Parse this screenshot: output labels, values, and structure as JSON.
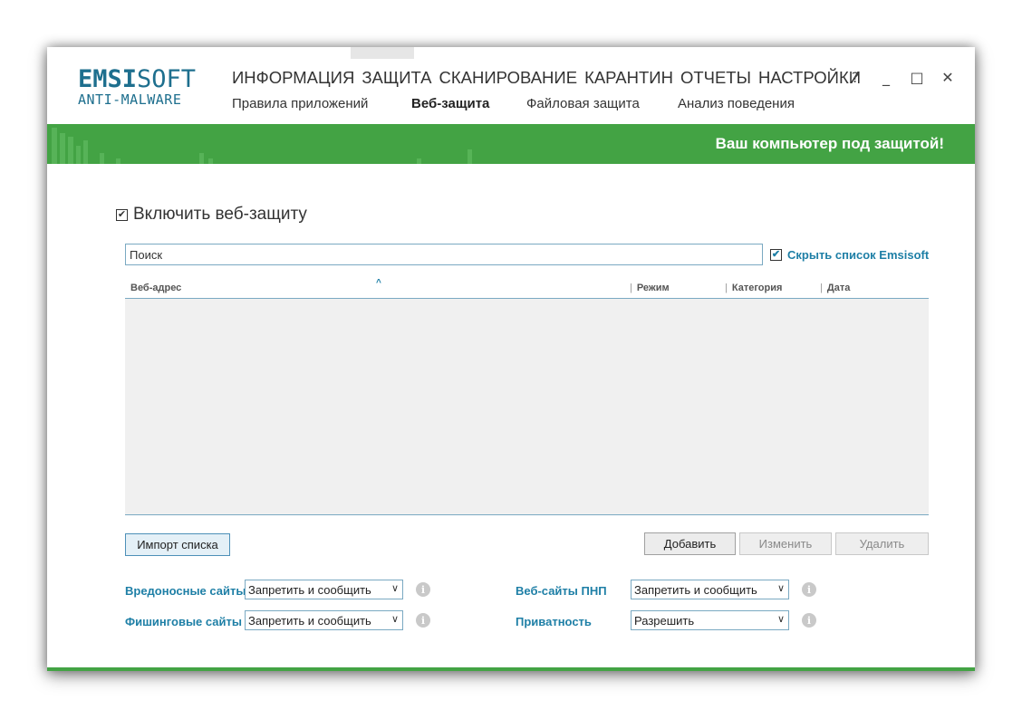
{
  "logo": {
    "brand_bold": "EMSI",
    "brand_light": "SOFT",
    "product": "ANTI-MALWARE"
  },
  "main_menu": [
    {
      "label": "ИНФОРМАЦИЯ"
    },
    {
      "label": "ЗАЩИТА"
    },
    {
      "label": "СКАНИРОВАНИЕ"
    },
    {
      "label": "КАРАНТИН"
    },
    {
      "label": "ОТЧЕТЫ"
    },
    {
      "label": "НАСТРОЙКИ"
    }
  ],
  "sub_menu": [
    {
      "label": "Правила приложений"
    },
    {
      "label": "Веб-защита",
      "active": true
    },
    {
      "label": "Файловая защита"
    },
    {
      "label": "Анализ поведения"
    }
  ],
  "window_controls": {
    "help": "?",
    "minimize": "_",
    "maximize": "□",
    "close": "✕"
  },
  "status": {
    "text": "Ваш компьютер под защитой!",
    "color": "#43a344"
  },
  "web_protection": {
    "enable_label": "Включить веб-защиту",
    "enabled": true
  },
  "search": {
    "value": "Поиск"
  },
  "hide_list": {
    "label": "Скрыть список Emsisoft",
    "checked": true
  },
  "table": {
    "columns": [
      "Веб-адрес",
      "Режим",
      "Категория",
      "Дата"
    ],
    "rows": []
  },
  "buttons": {
    "import": "Импорт списка",
    "add": "Добавить",
    "edit": "Изменить",
    "delete": "Удалить"
  },
  "options": {
    "malicious": {
      "label": "Вредоносные сайты",
      "value": "Запретить и сообщить"
    },
    "phishing": {
      "label": "Фишинговые сайты",
      "value": "Запретить и сообщить"
    },
    "pup": {
      "label": "Веб-сайты ПНП",
      "value": "Запретить и сообщить"
    },
    "privacy": {
      "label": "Приватность",
      "value": "Разрешить"
    }
  },
  "icons": {
    "checkbox_checked": "checkmark-icon",
    "info": "info-icon",
    "dropdown": "chevron-down-icon",
    "sort": "sort-up-icon"
  }
}
